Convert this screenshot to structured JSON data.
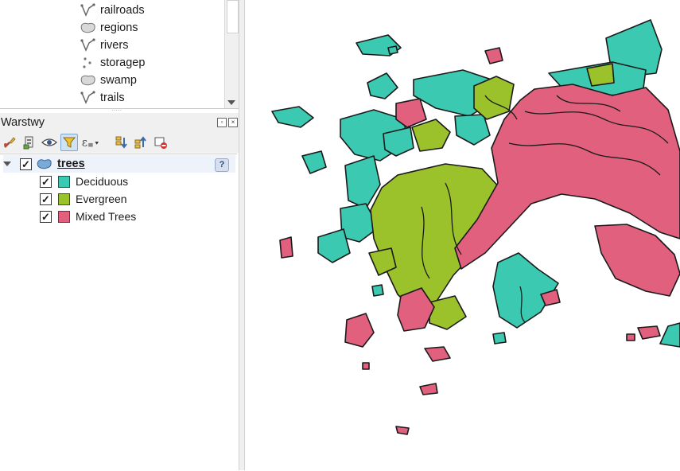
{
  "browser": {
    "items": [
      {
        "label": "railroads",
        "icon": "line-layer-icon"
      },
      {
        "label": "regions",
        "icon": "polygon-layer-icon"
      },
      {
        "label": "rivers",
        "icon": "line-layer-icon"
      },
      {
        "label": "storagep",
        "icon": "point-layer-icon"
      },
      {
        "label": "swamp",
        "icon": "polygon-layer-icon"
      },
      {
        "label": "trails",
        "icon": "line-layer-icon"
      }
    ]
  },
  "layers_panel": {
    "title": "Warstwy",
    "toolbar_icons": [
      "style-manager-icon",
      "add-group-icon",
      "visibility-eye-icon",
      "filter-legend-icon",
      "filter-expression-icon",
      "expand-all-icon",
      "collapse-all-icon",
      "remove-layer-icon"
    ],
    "layer": {
      "name": "trees",
      "checked": true,
      "classes": [
        {
          "label": "Deciduous",
          "color": "#3cc9b1",
          "checked": true
        },
        {
          "label": "Evergreen",
          "color": "#9cc22b",
          "checked": true
        },
        {
          "label": "Mixed Trees",
          "color": "#e0607e",
          "checked": true
        }
      ]
    }
  },
  "map": {
    "colors": {
      "deciduous": "#3cc9b1",
      "evergreen": "#9cc22b",
      "mixed": "#e0607e",
      "outline": "#1a1a1a"
    }
  }
}
